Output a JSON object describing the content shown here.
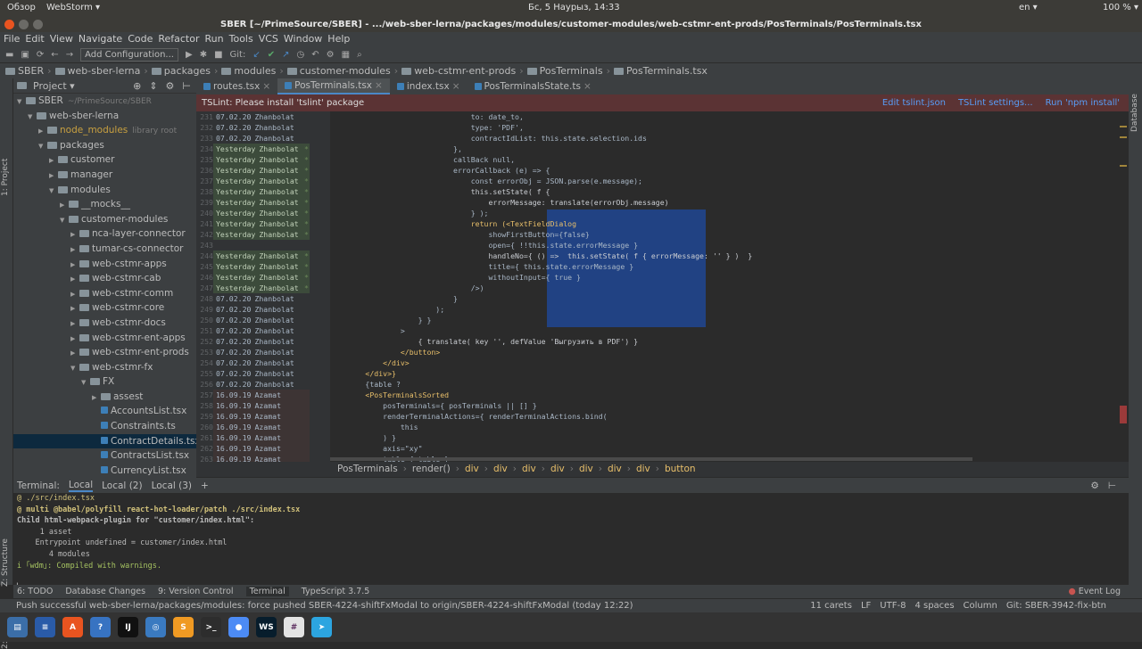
{
  "topbar": {
    "activities": "Обзор",
    "app": "WebStorm ▾",
    "datetime": "Бс, 5 Наурыз, 14:33",
    "lang": "en ▾",
    "battery": "100 % ▾"
  },
  "title": "SBER [~/PrimeSource/SBER] - .../web-sber-lerna/packages/modules/customer-modules/web-cstmr-ent-prods/PosTerminals/PosTerminals.tsx",
  "menu": [
    "File",
    "Edit",
    "View",
    "Navigate",
    "Code",
    "Refactor",
    "Run",
    "Tools",
    "VCS",
    "Window",
    "Help"
  ],
  "toolbar": {
    "config": "Add Configuration...",
    "git": "Git:"
  },
  "navbar": [
    "SBER",
    "web-sber-lerna",
    "packages",
    "modules",
    "customer-modules",
    "web-cstmr-ent-prods",
    "PosTerminals",
    "PosTerminals.tsx"
  ],
  "left_tools": {
    "project": "1: Project",
    "structure": "Z: Structure",
    "favorites": "2: Favorites"
  },
  "right_tools": {
    "database": "Database"
  },
  "project": {
    "title": "Project ▾",
    "tree": [
      {
        "label": "SBER",
        "extra": "~/PrimeSource/SBER",
        "d": 0,
        "o": 1
      },
      {
        "label": "web-sber-lerna",
        "d": 1,
        "o": 1
      },
      {
        "label": "node_modules",
        "extra": "library root",
        "d": 2,
        "o": 0
      },
      {
        "label": "packages",
        "d": 2,
        "o": 1
      },
      {
        "label": "customer",
        "d": 3,
        "o": 0
      },
      {
        "label": "manager",
        "d": 3,
        "o": 0
      },
      {
        "label": "modules",
        "d": 3,
        "o": 1
      },
      {
        "label": "__mocks__",
        "d": 4,
        "o": 0
      },
      {
        "label": "customer-modules",
        "d": 4,
        "o": 1
      },
      {
        "label": "nca-layer-connector",
        "d": 5,
        "o": 0
      },
      {
        "label": "tumar-cs-connector",
        "d": 5,
        "o": 0
      },
      {
        "label": "web-cstmr-apps",
        "d": 5,
        "o": 0
      },
      {
        "label": "web-cstmr-cab",
        "d": 5,
        "o": 0
      },
      {
        "label": "web-cstmr-comm",
        "d": 5,
        "o": 0
      },
      {
        "label": "web-cstmr-core",
        "d": 5,
        "o": 0
      },
      {
        "label": "web-cstmr-docs",
        "d": 5,
        "o": 0
      },
      {
        "label": "web-cstmr-ent-apps",
        "d": 5,
        "o": 0
      },
      {
        "label": "web-cstmr-ent-prods",
        "d": 5,
        "o": 0
      },
      {
        "label": "web-cstmr-fx",
        "d": 5,
        "o": 1
      },
      {
        "label": "FX",
        "d": 6,
        "o": 1
      },
      {
        "label": "assest",
        "d": 7,
        "o": 0
      },
      {
        "label": "AccountsList.tsx",
        "d": 7,
        "f": 1
      },
      {
        "label": "Constraints.ts",
        "d": 7,
        "f": 1
      },
      {
        "label": "ContractDetails.tsx",
        "d": 7,
        "f": 1,
        "sel": 1
      },
      {
        "label": "ContractsList.tsx",
        "d": 7,
        "f": 1
      },
      {
        "label": "CurrencyList.tsx",
        "d": 7,
        "f": 1
      }
    ]
  },
  "tabs": [
    {
      "label": "routes.tsx"
    },
    {
      "label": "PosTerminals.tsx",
      "active": 1
    },
    {
      "label": "index.tsx"
    },
    {
      "label": "PosTerminalsState.ts"
    }
  ],
  "tslint": {
    "message": "TSLint: Please install 'tslint' package",
    "actions": [
      "Edit tslint.json",
      "TSLint settings...",
      "Run 'npm install'"
    ]
  },
  "gutter": [
    {
      "n": "231",
      "d": "07.02.20",
      "a": "Zhanbolat"
    },
    {
      "n": "232",
      "d": "07.02.20",
      "a": "Zhanbolat"
    },
    {
      "n": "233",
      "d": "07.02.20",
      "a": "Zhanbolat"
    },
    {
      "n": "234",
      "d": "Yesterday",
      "a": "Zhanbolat",
      "g": 1
    },
    {
      "n": "235",
      "d": "Yesterday",
      "a": "Zhanbolat",
      "g": 1
    },
    {
      "n": "236",
      "d": "Yesterday",
      "a": "Zhanbolat",
      "g": 1
    },
    {
      "n": "237",
      "d": "Yesterday",
      "a": "Zhanbolat",
      "g": 1
    },
    {
      "n": "238",
      "d": "Yesterday",
      "a": "Zhanbolat",
      "g": 1
    },
    {
      "n": "239",
      "d": "Yesterday",
      "a": "Zhanbolat",
      "g": 1
    },
    {
      "n": "240",
      "d": "Yesterday",
      "a": "Zhanbolat",
      "g": 1
    },
    {
      "n": "241",
      "d": "Yesterday",
      "a": "Zhanbolat",
      "g": 1
    },
    {
      "n": "242",
      "d": "Yesterday",
      "a": "Zhanbolat",
      "g": 1
    },
    {
      "n": "243",
      "d": "",
      "a": ""
    },
    {
      "n": "244",
      "d": "Yesterday",
      "a": "Zhanbolat",
      "g": 1
    },
    {
      "n": "245",
      "d": "Yesterday",
      "a": "Zhanbolat",
      "g": 1
    },
    {
      "n": "246",
      "d": "Yesterday",
      "a": "Zhanbolat",
      "g": 1
    },
    {
      "n": "247",
      "d": "Yesterday",
      "a": "Zhanbolat",
      "g": 1
    },
    {
      "n": "248",
      "d": "07.02.20",
      "a": "Zhanbolat"
    },
    {
      "n": "249",
      "d": "07.02.20",
      "a": "Zhanbolat"
    },
    {
      "n": "250",
      "d": "07.02.20",
      "a": "Zhanbolat"
    },
    {
      "n": "251",
      "d": "07.02.20",
      "a": "Zhanbolat"
    },
    {
      "n": "252",
      "d": "07.02.20",
      "a": "Zhanbolat"
    },
    {
      "n": "253",
      "d": "07.02.20",
      "a": "Zhanbolat"
    },
    {
      "n": "254",
      "d": "07.02.20",
      "a": "Zhanbolat"
    },
    {
      "n": "255",
      "d": "07.02.20",
      "a": "Zhanbolat"
    },
    {
      "n": "256",
      "d": "07.02.20",
      "a": "Zhanbolat"
    },
    {
      "n": "257",
      "d": "16.09.19",
      "a": "Azamat",
      "b": 1
    },
    {
      "n": "258",
      "d": "16.09.19",
      "a": "Azamat",
      "b": 1
    },
    {
      "n": "259",
      "d": "16.09.19",
      "a": "Azamat",
      "b": 1
    },
    {
      "n": "260",
      "d": "16.09.19",
      "a": "Azamat",
      "b": 1
    },
    {
      "n": "261",
      "d": "16.09.19",
      "a": "Azamat",
      "b": 1
    },
    {
      "n": "262",
      "d": "16.09.19",
      "a": "Azamat",
      "b": 1
    },
    {
      "n": "263",
      "d": "16.09.19",
      "a": "Azamat",
      "b": 1
    }
  ],
  "code": [
    "                                to: date_to,",
    "                                type: 'PDF',",
    "                                contractIdList: this.state.selection.ids",
    "                            },",
    "                            callBack null,",
    "                            errorCallback (e) => {",
    "                                const errorObj = JSON.parse(e.message);",
    "                                this.setState( f {",
    "                                    errorMessage: translate(errorObj.message)",
    "                                } );",
    "                                return (<TextFieldDialog",
    "                                    showFirstButton={false}",
    "                                    open={ !!this.state.errorMessage }",
    "                                    handleNo={ () =>  this.setState( f { errorMessage: '' } )  }",
    "                                    title={ this.state.errorMessage }",
    "                                    withoutInput={ true }",
    "                                />)",
    "                            }",
    "                        );",
    "                    } }",
    "                >",
    "                    { translate( key '', defValue 'Выгрузить в PDF') }",
    "                </button>",
    "            </div>",
    "        </div>}",
    "        {table ?",
    "        <PosTerminalsSorted",
    "            posTerminals={ posTerminals || [] }",
    "            renderTerminalActions={ renderTerminalActions.bind(",
    "                this",
    "            ) }",
    "            axis=\"xy\"",
    "            table={ table }"
  ],
  "breadcrumb": [
    "PosTerminals",
    "render()",
    "div",
    "div",
    "div",
    "div",
    "div",
    "div",
    "div",
    "button"
  ],
  "terminal": {
    "label": "Terminal:",
    "tabs": [
      "Local",
      "Local (2)",
      "Local (3)"
    ],
    "add": "+",
    "lines": [
      "@ ./src/index.tsx",
      "@ multi @babel/polyfill react-hot-loader/patch ./src/index.tsx",
      "Child html-webpack-plugin for \"customer/index.html\":",
      "     1 asset",
      "    Entrypoint undefined = customer/index.html",
      "       4 modules",
      "i ｢wdm｣: Compiled with warnings.",
      ""
    ]
  },
  "toolwindows": [
    "6: TODO",
    "Database Changes",
    "9: Version Control",
    "Terminal",
    "TypeScript 3.7.5"
  ],
  "eventlog": "Event Log",
  "status": {
    "message": "Push successful web-sber-lerna/packages/modules: force pushed SBER-4224-shiftFxModal to origin/SBER-4224-shiftFxModal (today 12:22)",
    "carets": "11 carets",
    "lf": "LF",
    "enc": "UTF-8",
    "indent": "4 spaces",
    "col": "Column",
    "branch": "Git: SBER-3942-fix-btn"
  },
  "dock": [
    {
      "n": "files-icon",
      "c": "#3b6ea8",
      "t": "▤"
    },
    {
      "n": "docs-icon",
      "c": "#2a5ba8",
      "t": "≡"
    },
    {
      "n": "store-icon",
      "c": "#e95420",
      "t": "A"
    },
    {
      "n": "help-icon",
      "c": "#3773c2",
      "t": "?"
    },
    {
      "n": "idea-icon",
      "c": "#111",
      "t": "IJ"
    },
    {
      "n": "browser-icon",
      "c": "#3a7ac0",
      "t": "◎"
    },
    {
      "n": "sublime-icon",
      "c": "#f09a23",
      "t": "S"
    },
    {
      "n": "terminal-icon",
      "c": "#2d2d2d",
      "t": ">_"
    },
    {
      "n": "chrome-icon",
      "c": "#4c8bf5",
      "t": "●"
    },
    {
      "n": "webstorm-icon",
      "c": "#071d2c",
      "t": "WS"
    },
    {
      "n": "slack-icon",
      "c": "#e3e3e3",
      "t": "#"
    },
    {
      "n": "telegram-icon",
      "c": "#2ca5e0",
      "t": "➤"
    }
  ]
}
